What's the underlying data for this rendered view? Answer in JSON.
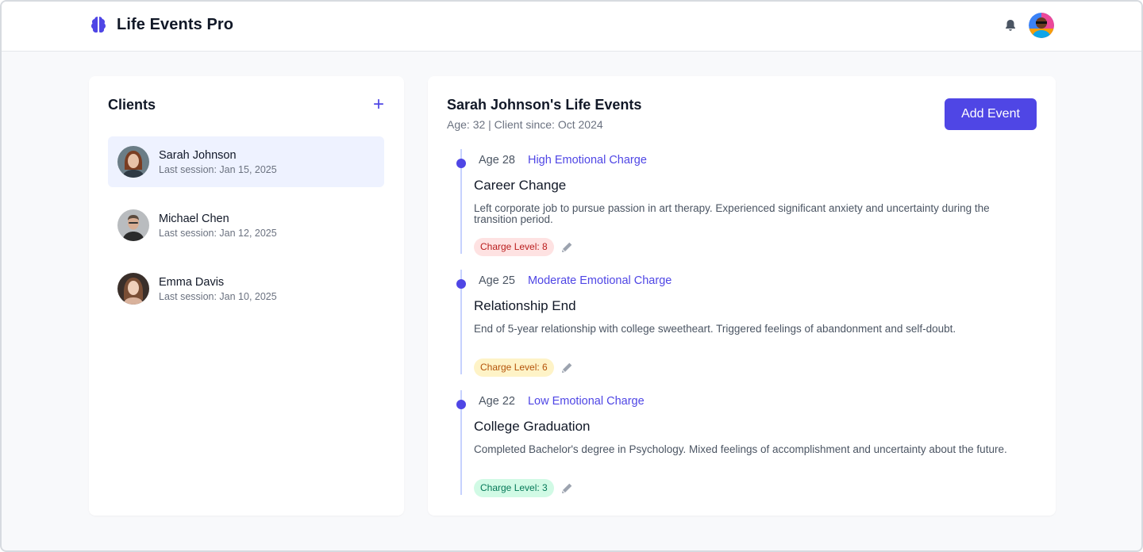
{
  "app": {
    "title": "Life Events Pro",
    "accent_color": "#4f46e5",
    "brand_icon": "brain-icon",
    "notification_icon": "bell-icon"
  },
  "clients": {
    "title": "Clients",
    "add_icon": "plus-icon",
    "items": [
      {
        "name": "Sarah Johnson",
        "last_session": "Last session: Jan 15, 2025",
        "active": true
      },
      {
        "name": "Michael Chen",
        "last_session": "Last session: Jan 12, 2025",
        "active": false
      },
      {
        "name": "Emma Davis",
        "last_session": "Last session: Jan 10, 2025",
        "active": false
      }
    ]
  },
  "events": {
    "title": "Sarah Johnson's Life Events",
    "subtitle": "Age: 32 | Client since: Oct 2024",
    "add_button": "Add Event",
    "items": [
      {
        "age": "Age 28",
        "charge": "High Emotional Charge",
        "title": "Career Change",
        "description": "Left corporate job to pursue passion in art therapy. Experienced significant anxiety and uncertainty during the transition period.",
        "level_label": "Charge Level: 8",
        "level_color": "#fee2e2"
      },
      {
        "age": "Age 25",
        "charge": "Moderate Emotional Charge",
        "title": "Relationship End",
        "description": "End of 5-year relationship with college sweetheart. Triggered feelings of abandonment and self-doubt.",
        "level_label": "Charge Level: 6",
        "level_color": "#fef3c7"
      },
      {
        "age": "Age 22",
        "charge": "Low Emotional Charge",
        "title": "College Graduation",
        "description": "Completed Bachelor's degree in Psychology. Mixed feelings of accomplishment and uncertainty about the future.",
        "level_label": "Charge Level: 3",
        "level_color": "#d1fae5"
      }
    ]
  }
}
